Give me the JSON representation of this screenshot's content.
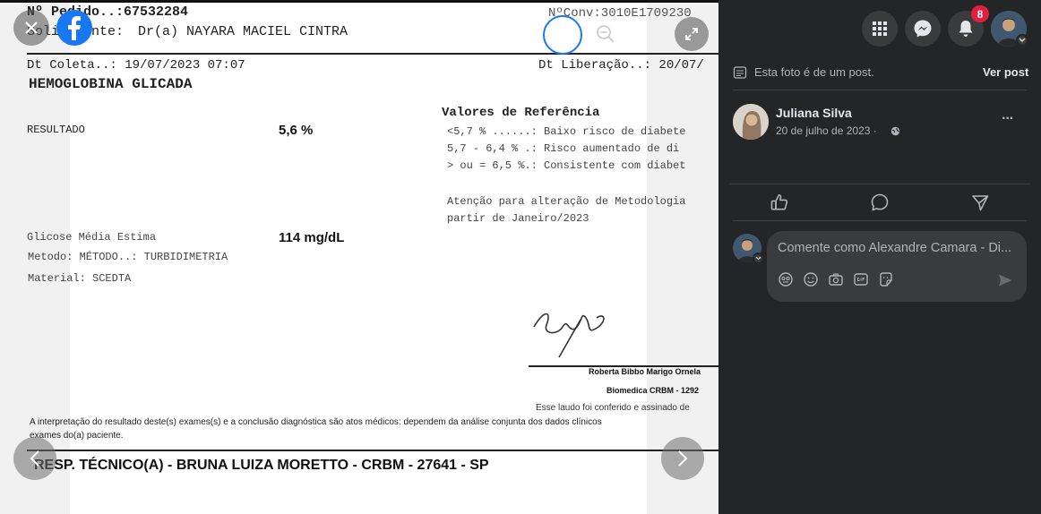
{
  "report": {
    "pedido": "Nº Pedido..:67532284",
    "solicitante_label": "Solicitante:",
    "solicitante": "Dr(a) NAYARA MACIEL CINTRA",
    "conv": "NºConv:3010E1709230",
    "coleta": "Dt Coleta..: 19/07/2023 07:07",
    "liberacao": "Dt Liberação..: 20/07/",
    "exam_title": "HEMOGLOBINA GLICADA",
    "resultado_label": "RESULTADO",
    "resultado_value": "5,6 %",
    "ref_title": "Valores de Referência",
    "ref_line1": "<5,7 % ......: Baixo risco de diabete",
    "ref_line2": "5,7 - 6,4 % .: Risco aumentado de di",
    "ref_line3": "> ou = 6,5 %.: Consistente com diabet",
    "atencao_line1": "Atenção para alteração de Metodologia",
    "atencao_line2": "partir de Janeiro/2023",
    "glicose_label": "Glicose Média Estima",
    "glicose_value": "114 mg/dL",
    "metodo": "Metodo: MÉTODO..: TURBIDIMETRIA",
    "material": "Material: SCEDTA",
    "sig_name": "Roberta Bibbo Marigo Ornela",
    "sig_role": "Biomedica CRBM - 1292",
    "laudo": "Esse laudo foi conferido e assinado de",
    "disclaimer_line1": "A interpretação do resultado deste(s) exames(s) e a conclusão diagnóstica são atos médicos: dependem da análise conjunta dos dados clínicos",
    "disclaimer_line2": "exames do(a) paciente.",
    "resp": "RESP. TÉCNICO(A) - BRUNA LUIZA MORETTO - CRBM - 27641 - SP"
  },
  "viewer_controls": {
    "close_icon": "close-icon",
    "logo": "facebook-logo",
    "zoom_in_icon": "zoom-in-icon",
    "zoom_out_icon": "zoom-out-icon",
    "fullscreen_icon": "fullscreen-icon",
    "prev_icon": "chevron-left-icon",
    "next_icon": "chevron-right-icon"
  },
  "topbar": {
    "notifications_count": "8"
  },
  "post": {
    "info": "Esta foto é de um post.",
    "view_post": "Ver post",
    "author": "Juliana Silva",
    "date": "20 de julho de 2023 ·",
    "more": "···",
    "comment_placeholder": "Comente como Alexandre Camara - Di..."
  },
  "colors": {
    "panel_bg": "#242526",
    "accent_blue": "#1877f2",
    "badge_red": "#e41e3f"
  }
}
